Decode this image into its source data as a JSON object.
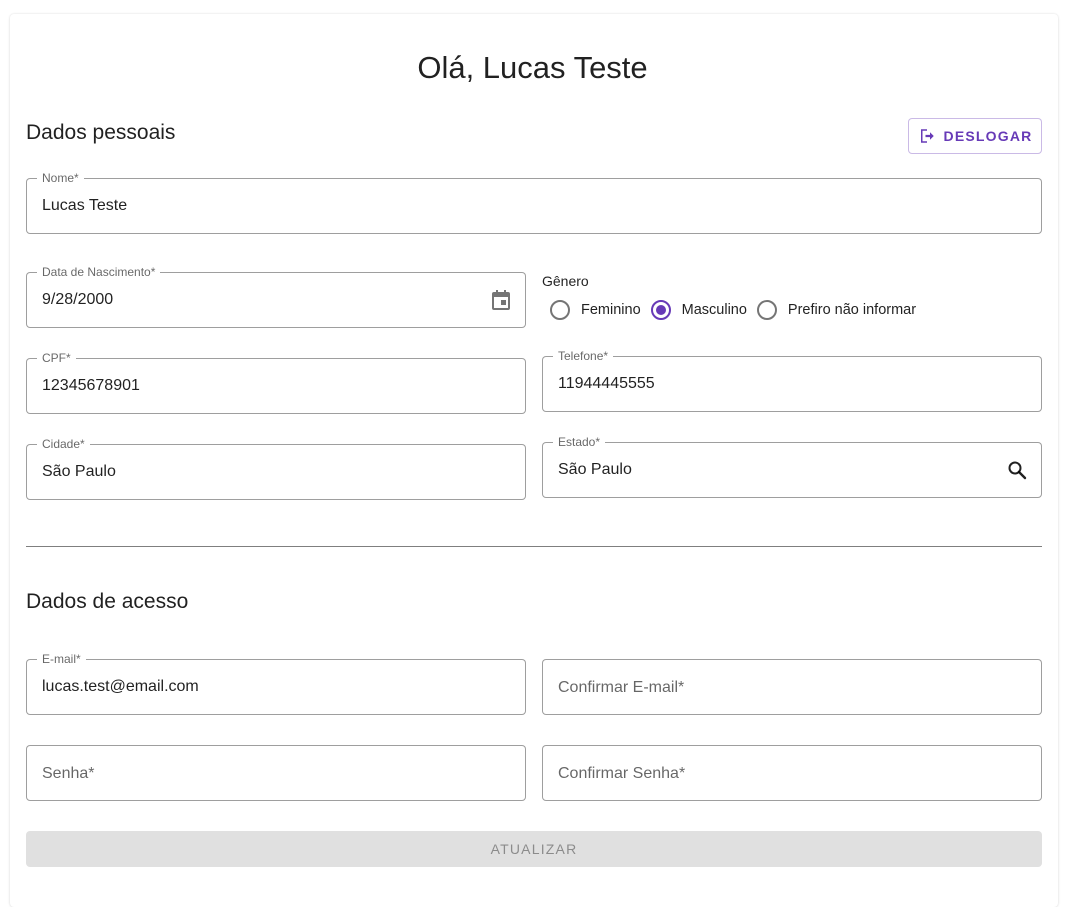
{
  "header": {
    "greeting": "Olá, Lucas Teste"
  },
  "personal": {
    "section_title": "Dados pessoais",
    "logout_label": "DESLOGAR",
    "name": {
      "label": "Nome*",
      "value": "Lucas Teste"
    },
    "birth": {
      "label": "Data de Nascimento*",
      "value": "9/28/2000",
      "icon": "calendar-icon"
    },
    "gender": {
      "label": "Gênero",
      "options": [
        "Feminino",
        "Masculino",
        "Prefiro não informar"
      ],
      "selected": "Masculino"
    },
    "cpf": {
      "label": "CPF*",
      "value": "12345678901"
    },
    "phone": {
      "label": "Telefone*",
      "value": "11944445555"
    },
    "city": {
      "label": "Cidade*",
      "value": "São Paulo"
    },
    "state": {
      "label": "Estado*",
      "value": "São Paulo",
      "icon": "search-icon"
    }
  },
  "access": {
    "section_title": "Dados de acesso",
    "email": {
      "label": "E-mail*",
      "value": "lucas.test@email.com"
    },
    "confirm_email": {
      "placeholder": "Confirmar E-mail*"
    },
    "password": {
      "placeholder": "Senha*"
    },
    "confirm_password": {
      "placeholder": "Confirmar Senha*"
    }
  },
  "submit_label": "ATUALIZAR",
  "colors": {
    "primary": "#673ab7",
    "disabled_bg": "#e0e0e0"
  }
}
